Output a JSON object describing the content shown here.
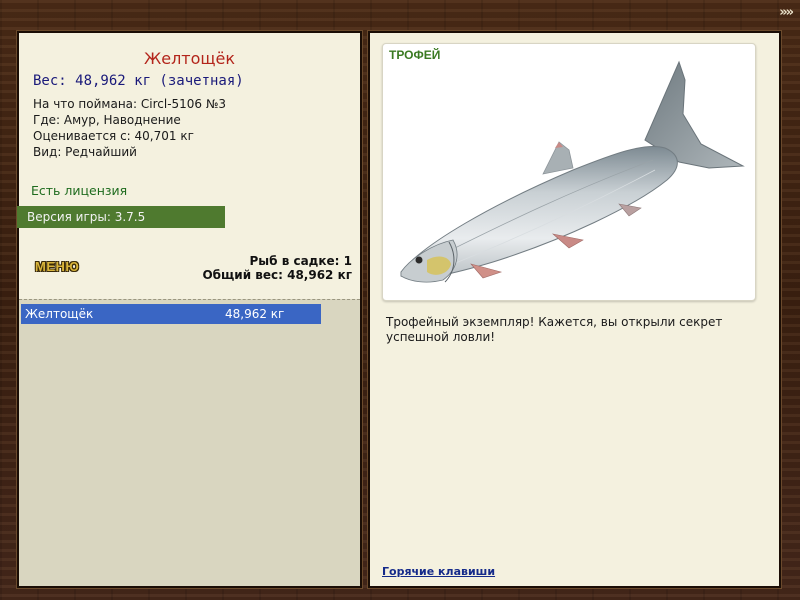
{
  "top_nav": {
    "arrows_icon": "triple-chevron-right-icon",
    "arrows_text": "»»"
  },
  "fish_card": {
    "name": "Желтощёк",
    "weight_line": "Вес: 48,962 кг (зачетная)",
    "caught_on": "На что поймана: Circl-5106 №3",
    "location": "Где: Амур, Наводнение",
    "valued_from": "Оценивается с: 40,701 кг",
    "rarity": "Вид: Редчайший"
  },
  "license": "Есть лицензия",
  "version": "Версия игры: 3.7.5",
  "menu_label": "МЕНЮ",
  "keepnet": {
    "fish_count": "Рыб в садке: 1",
    "total_weight": "Общий вес: 48,962 кг"
  },
  "catch_list": [
    {
      "name": "Желтощёк",
      "weight": "48,962 кг"
    }
  ],
  "trophy": {
    "label": "ТРОФЕЙ",
    "description": "Трофейный экземпляр! Кажется, вы открыли секрет успешной ловли!"
  },
  "hotkeys_link": "Горячие клавиши",
  "colors": {
    "fish_name": "#b3251b",
    "weight": "#1a1a7a",
    "license": "#1e6b1e",
    "version_bar": "#4f7a2f",
    "selection": "#3a66c4",
    "trophy_label": "#3a7a22",
    "link": "#142a8a"
  }
}
